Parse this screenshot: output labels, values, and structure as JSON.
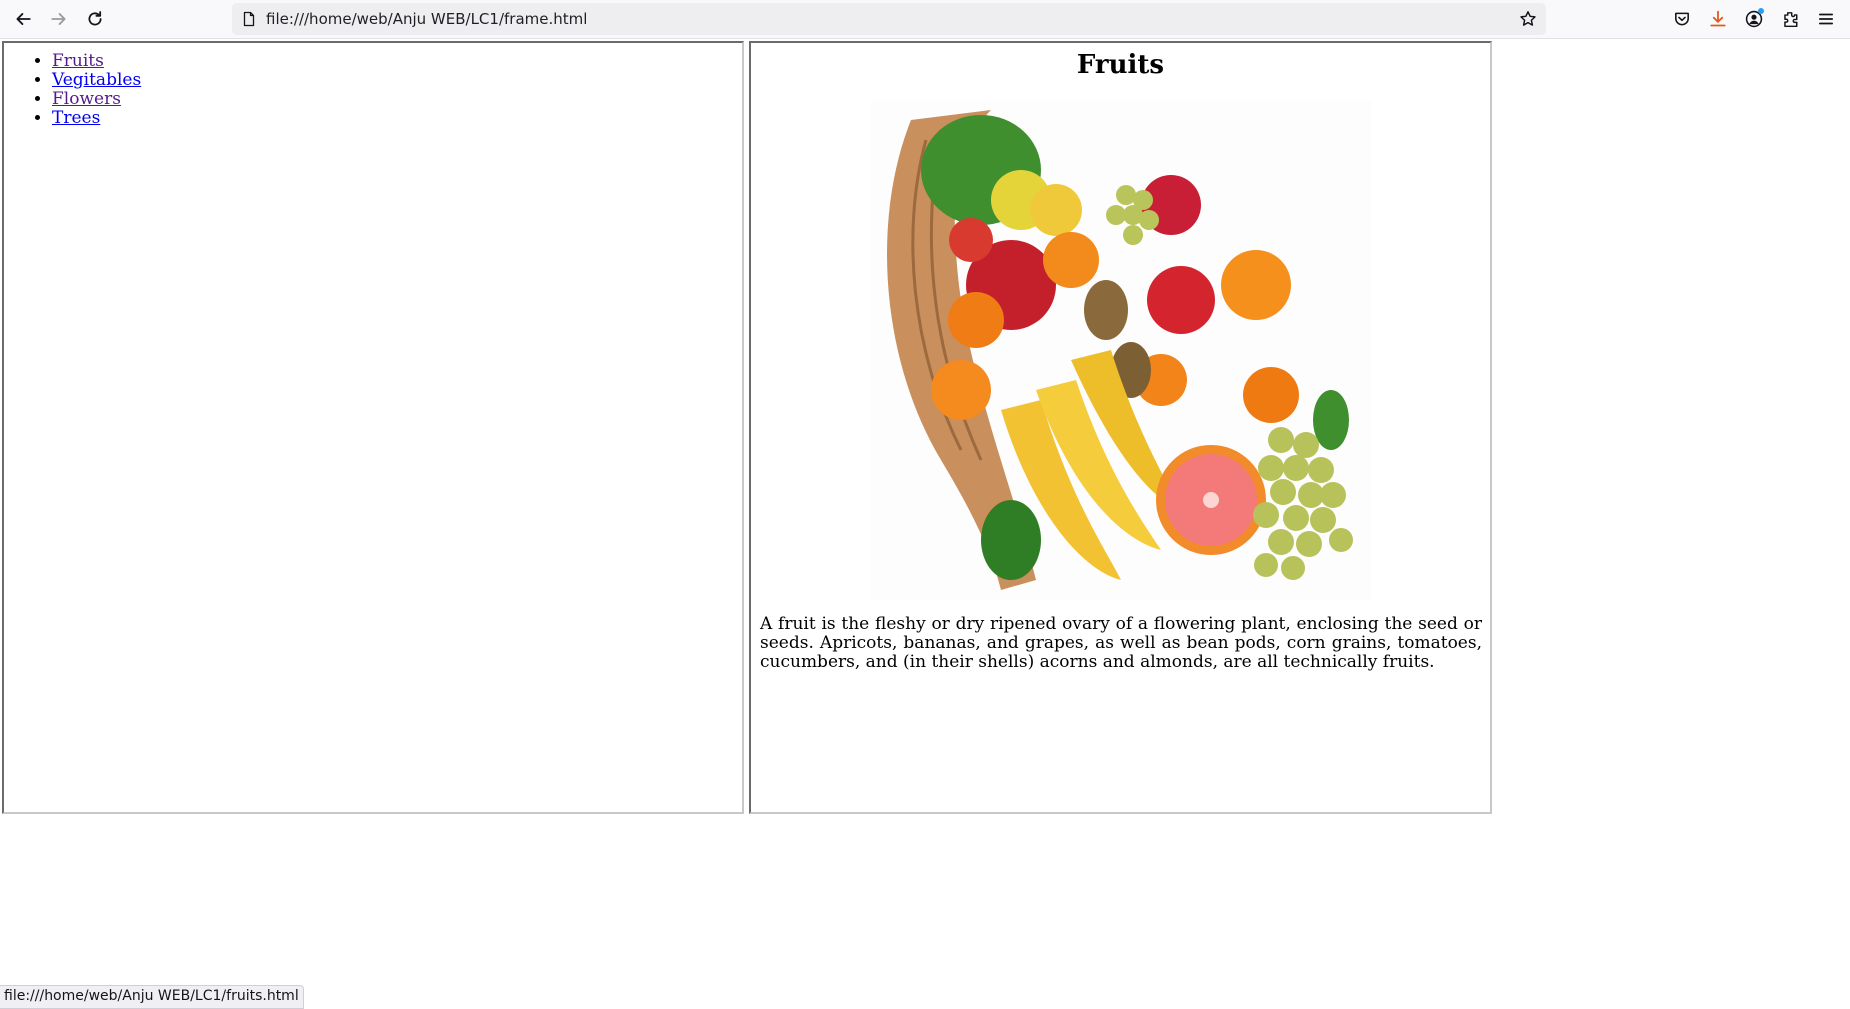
{
  "browser": {
    "url": "file:///home/web/Anju WEB/LC1/frame.html",
    "status_url": "file:///home/web/Anju WEB/LC1/fruits.html",
    "icons": [
      "back-icon",
      "forward-icon",
      "reload-icon",
      "page-icon",
      "bookmark-star-icon",
      "pocket-icon",
      "download-icon",
      "account-icon",
      "extensions-icon",
      "menu-icon"
    ],
    "accent_download": "#e25920",
    "accent_badge": "#2a9df4"
  },
  "nav": {
    "items": [
      {
        "label": "Fruits",
        "visited": true
      },
      {
        "label": "Vegitables",
        "visited": false
      },
      {
        "label": "Flowers",
        "visited": true
      },
      {
        "label": "Trees",
        "visited": false
      }
    ]
  },
  "content": {
    "heading": "Fruits",
    "image": "fruit-basket-image",
    "paragraph": "A fruit is the fleshy or dry ripened ovary of a flowering plant, enclosing the seed or seeds. Apricots, bananas, and grapes, as well as bean pods, corn grains, tomatoes, cucumbers, and (in their shells) acorns and almonds, are all technically fruits."
  }
}
